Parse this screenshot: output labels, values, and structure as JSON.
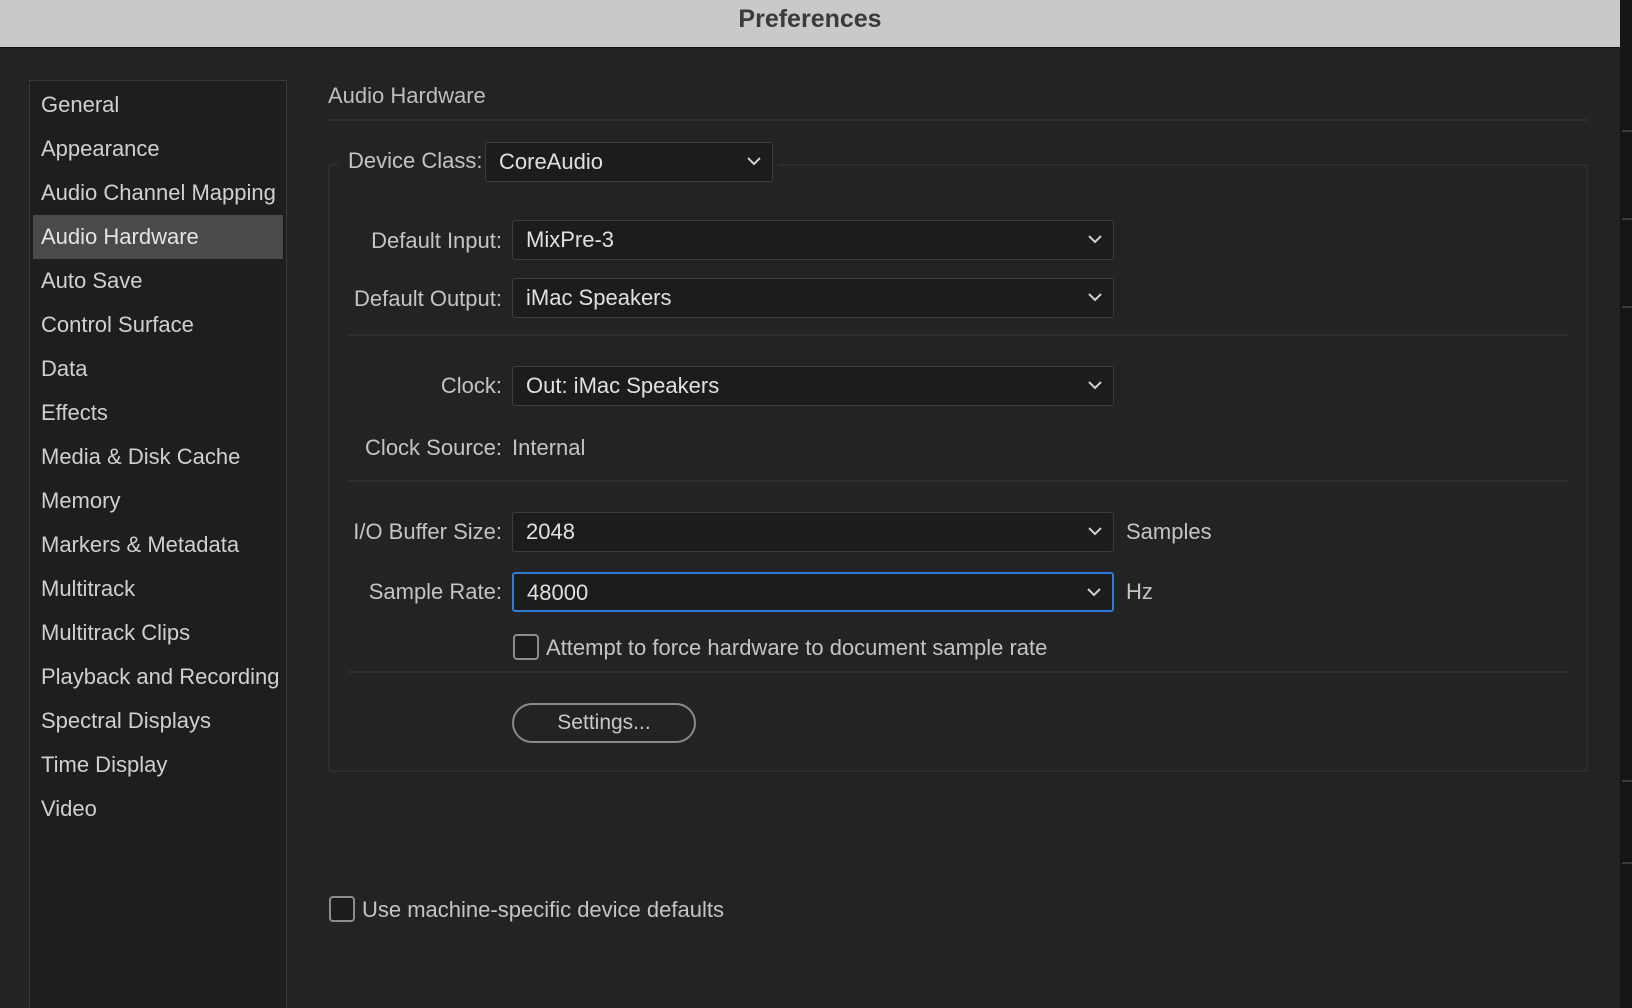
{
  "window": {
    "title": "Preferences"
  },
  "sidebar": {
    "items": [
      {
        "label": "General"
      },
      {
        "label": "Appearance"
      },
      {
        "label": "Audio Channel Mapping"
      },
      {
        "label": "Audio Hardware",
        "selected": true
      },
      {
        "label": "Auto Save"
      },
      {
        "label": "Control Surface"
      },
      {
        "label": "Data"
      },
      {
        "label": "Effects"
      },
      {
        "label": "Media & Disk Cache"
      },
      {
        "label": "Memory"
      },
      {
        "label": "Markers & Metadata"
      },
      {
        "label": "Multitrack"
      },
      {
        "label": "Multitrack Clips"
      },
      {
        "label": "Playback and Recording"
      },
      {
        "label": "Spectral Displays"
      },
      {
        "label": "Time Display"
      },
      {
        "label": "Video"
      }
    ]
  },
  "main": {
    "section_title": "Audio Hardware",
    "device_class": {
      "label": "Device Class:",
      "value": "CoreAudio"
    },
    "default_input": {
      "label": "Default Input:",
      "value": "MixPre-3"
    },
    "default_output": {
      "label": "Default Output:",
      "value": "iMac Speakers"
    },
    "clock": {
      "label": "Clock:",
      "value": "Out: iMac Speakers"
    },
    "clock_source": {
      "label": "Clock Source:",
      "value": "Internal"
    },
    "io_buffer": {
      "label": "I/O Buffer Size:",
      "value": "2048",
      "unit": "Samples"
    },
    "sample_rate": {
      "label": "Sample Rate:",
      "value": "48000",
      "unit": "Hz"
    },
    "force_rate": {
      "label": "Attempt to force hardware to document sample rate",
      "checked": false
    },
    "settings_button": "Settings...",
    "machine_defaults": {
      "label": "Use machine-specific device defaults",
      "checked": false
    }
  },
  "colors": {
    "accent_focus": "#2f7bd8",
    "selected_item": "#4a4a4a",
    "panel_bg": "#232323"
  }
}
